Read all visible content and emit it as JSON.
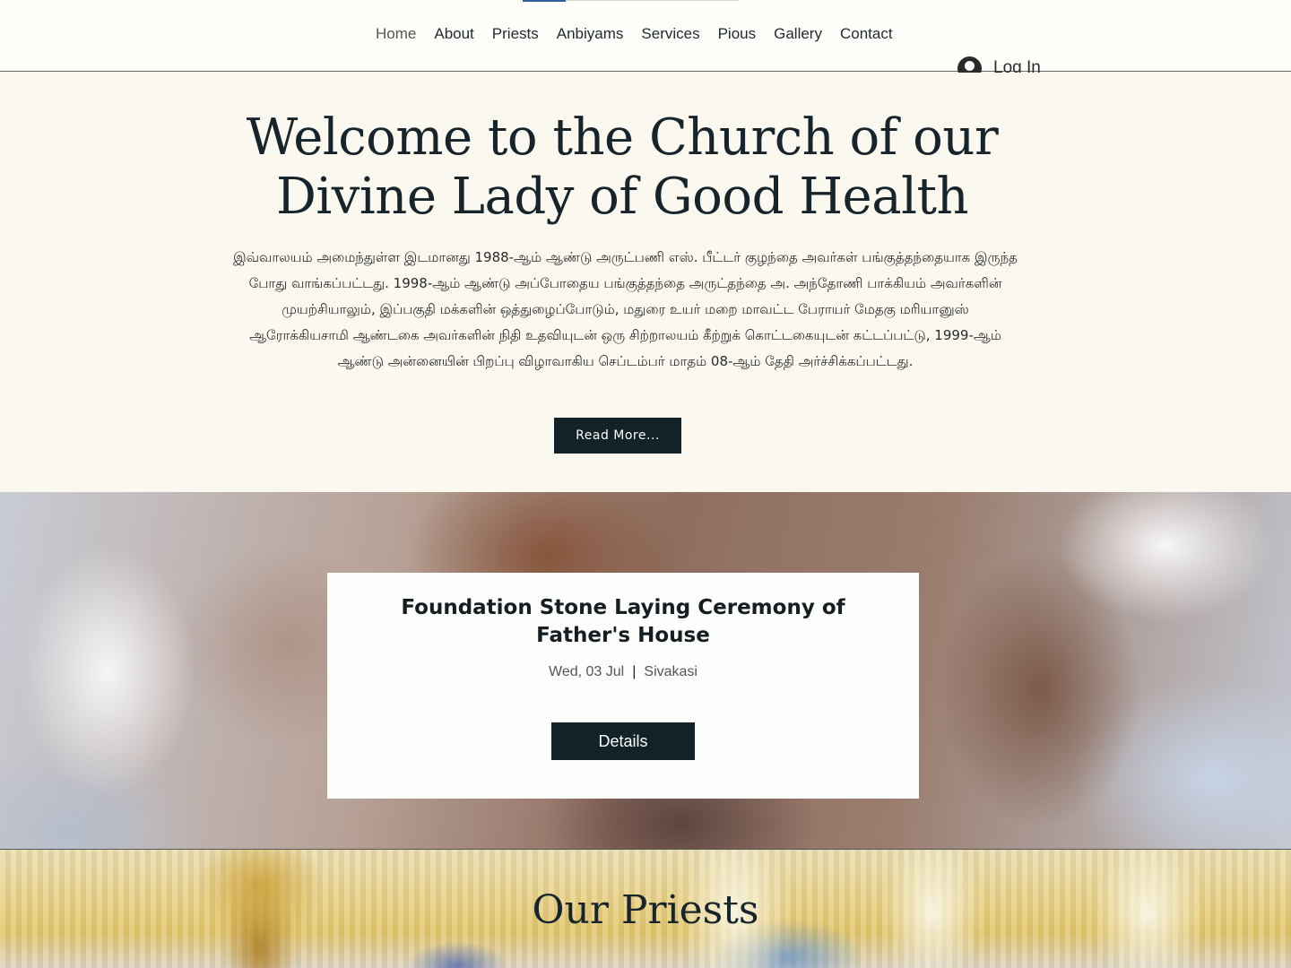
{
  "nav": {
    "items": [
      "Home",
      "About",
      "Priests",
      "Anbiyams",
      "Services",
      "Pious",
      "Gallery",
      "Contact"
    ],
    "login_label": "Log In"
  },
  "hero": {
    "title": "Welcome to the Church of our Divine Lady of Good Health",
    "paragraph": "இவ்வாலயம் அமைந்துள்ள இடமானது 1988-ஆம் ஆண்டு அருட்பணி எஸ். பீட்டர் குழந்தை அவர்கள் பங்குத்தந்தையாக இருந்த போது வாங்கப்பட்டது. 1998-ஆம் ஆண்டு அப்போதைய பங்குத்தந்தை அருட்தந்தை அ. அந்தோணி பாக்கியம் அவர்களின் முயற்சியாலும், இப்பகுதி மக்களின் ஒத்துழைப்போடும், மதுரை உயர் மறை மாவட்ட பேராயர் மேதகு மரியானுஸ் ஆரோக்கியசாமி ஆண்டகை அவர்களின் நிதி உதவியுடன் ஒரு சிற்றாலயம் கீற்றுக் கொட்டகையுடன் கட்டப்பட்டு, 1999-ஆம் ஆண்டு அன்னையின் பிறப்பு விழாவாகிய செப்டம்பர் மாதம் 08-ஆம் தேதி அர்ச்சிக்கப்பட்டது.",
    "read_more_label": "Read More..."
  },
  "event": {
    "title": "Foundation Stone Laying Ceremony of Father's House",
    "date": "Wed, 03 Jul",
    "separator": "|",
    "location": "Sivakasi",
    "details_label": "Details"
  },
  "priests": {
    "title": "Our Priests"
  },
  "colors": {
    "dark_button": "#132128",
    "hero_bg": "#fbf9ef",
    "nav_active_indicator": "#2f5f9d"
  }
}
